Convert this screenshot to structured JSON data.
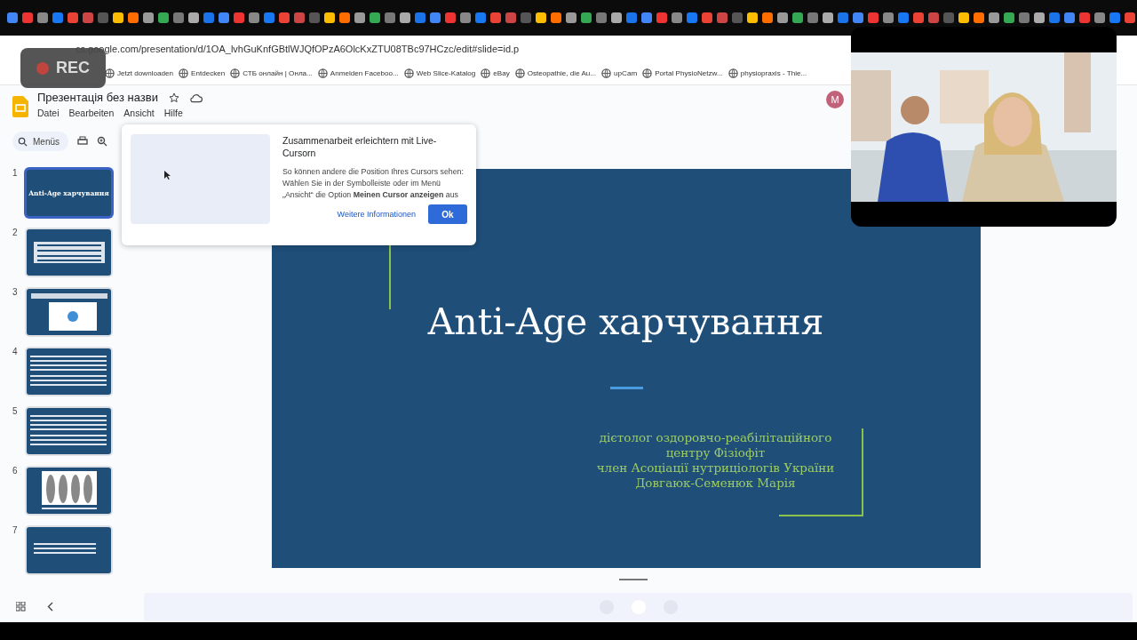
{
  "recording_badge": {
    "label": "REC"
  },
  "address_bar": {
    "url": "cs.google.com/presentation/d/1OA_lvhGuKnfGBtlWJQfOPzA6OlcKxZTU08TBc97HCzc/edit#slide=id.p"
  },
  "bookmarks": [
    {
      "label": "Jetzt downloaden"
    },
    {
      "label": "Entdecken"
    },
    {
      "label": "СТБ онлайн | Онла..."
    },
    {
      "label": "Anmelden  Faceboo..."
    },
    {
      "label": "Web Slice-Katalog"
    },
    {
      "label": "eBay"
    },
    {
      "label": "Osteopathie, die Au..."
    },
    {
      "label": "upCam"
    },
    {
      "label": "Portal PhysioNetzw..."
    },
    {
      "label": "physiopraxis - Thie..."
    }
  ],
  "document": {
    "title": "Презентація без назви",
    "avatar": "M",
    "menu": [
      "Datei",
      "Bearbeiten",
      "Ansicht",
      "Hilfe"
    ]
  },
  "toolbar": {
    "search_placeholder": "Menüs"
  },
  "slides": [
    {
      "number": "1",
      "kind": "title",
      "title": "Anti-Age харчування",
      "selected": true
    },
    {
      "number": "2",
      "kind": "banner",
      "selected": false
    },
    {
      "number": "3",
      "kind": "diagram",
      "selected": false
    },
    {
      "number": "4",
      "kind": "text",
      "selected": false
    },
    {
      "number": "5",
      "kind": "text",
      "selected": false
    },
    {
      "number": "6",
      "kind": "figures",
      "selected": false
    },
    {
      "number": "7",
      "kind": "short",
      "selected": false
    }
  ],
  "popup": {
    "title": "Zusammenarbeit erleichtern mit Live-Cursorn",
    "body": "So können andere die Position Ihres Cursors sehen: Wählen Sie in der Symbolleiste oder im Menü „Ansicht“ die Option **Meinen Cursor anzeigen** aus",
    "link": "Weitere Informationen",
    "button": "Ok"
  },
  "current_slide": {
    "title": "Anti-Age харчування",
    "subtitle_lines": [
      "дієтолог оздоровчо-реабілітаційного",
      "центру Фізіофіт",
      "член Асоціації нутриціологів України",
      "Довгаюк-Семенюк Марія"
    ]
  }
}
